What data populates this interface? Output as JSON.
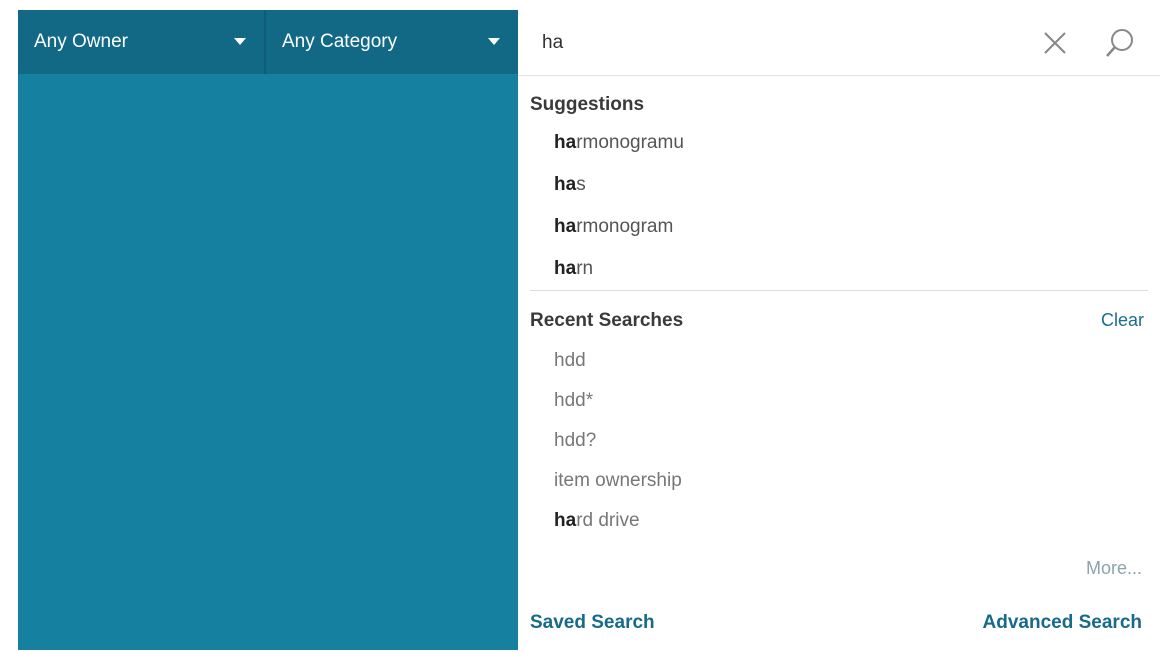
{
  "filters": {
    "owner": "Any Owner",
    "category": "Any Category"
  },
  "search": {
    "query": "ha",
    "clear_icon": "close-icon",
    "search_icon": "magnifier-icon"
  },
  "suggestions": {
    "title": "Suggestions",
    "items": [
      {
        "match": "ha",
        "rest": "rmonogramu"
      },
      {
        "match": "ha",
        "rest": "s"
      },
      {
        "match": "ha",
        "rest": "rmonogram"
      },
      {
        "match": "ha",
        "rest": "rn"
      }
    ]
  },
  "recent": {
    "title": "Recent Searches",
    "clear_label": "Clear",
    "items": [
      {
        "match": "",
        "rest": "hdd"
      },
      {
        "match": "",
        "rest": "hdd*"
      },
      {
        "match": "",
        "rest": "hdd?"
      },
      {
        "match": "",
        "rest": "item ownership"
      },
      {
        "match": "ha",
        "rest": "rd drive"
      }
    ],
    "more_label": "More..."
  },
  "footer": {
    "saved_search": "Saved Search",
    "advanced_search": "Advanced Search"
  },
  "colors": {
    "background": "#15809f",
    "filter_bar": "#116985",
    "link": "#1b6f8d"
  }
}
